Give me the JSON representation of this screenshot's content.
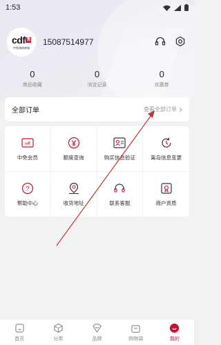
{
  "status": {
    "time": "1:53"
  },
  "profile": {
    "logo_text": "cdf",
    "logo_sub": "中免海南商城",
    "phone": "15087514977"
  },
  "stats": [
    {
      "value": "0",
      "label": "商品收藏"
    },
    {
      "value": "0",
      "label": "浏览记录"
    },
    {
      "value": "0",
      "label": "优惠券"
    }
  ],
  "orders": {
    "title": "全部订单",
    "more": "查看全部订单"
  },
  "services": [
    {
      "label": "中免会员",
      "icon": "member-card-icon"
    },
    {
      "label": "额度查询",
      "icon": "quota-icon"
    },
    {
      "label": "购买信息验证",
      "icon": "id-verify-icon"
    },
    {
      "label": "离岛信息变更",
      "icon": "refresh-icon"
    },
    {
      "label": "帮助中心",
      "icon": "help-icon"
    },
    {
      "label": "收货地址",
      "icon": "location-icon"
    },
    {
      "label": "联系客服",
      "icon": "headset-icon"
    },
    {
      "label": "商户资质",
      "icon": "certificate-icon"
    }
  ],
  "tabs": [
    {
      "label": "首页",
      "icon": "home-icon"
    },
    {
      "label": "分类",
      "icon": "category-icon"
    },
    {
      "label": "品牌",
      "icon": "brand-icon"
    },
    {
      "label": "购物袋",
      "icon": "bag-icon"
    },
    {
      "label": "我的",
      "icon": "profile-icon",
      "active": true
    }
  ],
  "colors": {
    "accent": "#c8102e",
    "arrow": "#c0392b"
  }
}
